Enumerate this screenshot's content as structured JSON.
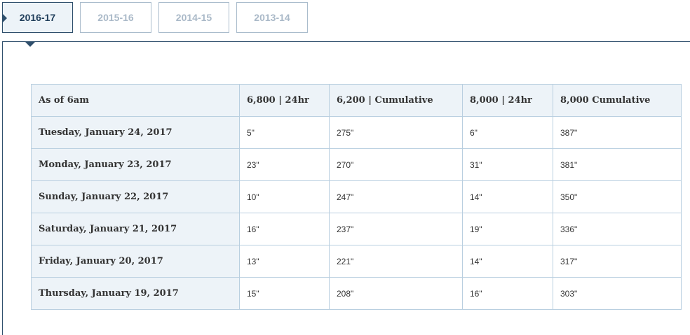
{
  "tabs": [
    {
      "label": "2016-17",
      "active": true
    },
    {
      "label": "2015-16",
      "active": false
    },
    {
      "label": "2014-15",
      "active": false
    },
    {
      "label": "2013-14",
      "active": false
    }
  ],
  "table": {
    "headers": [
      "As of 6am",
      "6,800 | 24hr",
      "6,200 | Cumulative",
      "8,000 | 24hr",
      "8,000 Cumulative"
    ],
    "rows": [
      {
        "date": "Tuesday, January 24, 2017",
        "c6800_24": "5\"",
        "c6200_cum": "275\"",
        "c8000_24": "6\"",
        "c8000_cum": "387\""
      },
      {
        "date": "Monday, January 23, 2017",
        "c6800_24": "23\"",
        "c6200_cum": "270\"",
        "c8000_24": "31\"",
        "c8000_cum": "381\""
      },
      {
        "date": "Sunday, January 22, 2017",
        "c6800_24": "10\"",
        "c6200_cum": "247\"",
        "c8000_24": "14\"",
        "c8000_cum": "350\""
      },
      {
        "date": "Saturday, January 21, 2017",
        "c6800_24": "16\"",
        "c6200_cum": "237\"",
        "c8000_24": "19\"",
        "c8000_cum": "336\""
      },
      {
        "date": "Friday, January 20, 2017",
        "c6800_24": "13\"",
        "c6200_cum": "221\"",
        "c8000_24": "14\"",
        "c8000_cum": "317\""
      },
      {
        "date": "Thursday, January 19, 2017",
        "c6800_24": "15\"",
        "c6200_cum": "208\"",
        "c8000_24": "16\"",
        "c8000_cum": "303\""
      }
    ]
  },
  "colors": {
    "accent": "#2f4f6c",
    "tab_inactive_text": "#aab9c8",
    "header_bg": "#edf3f8",
    "border": "#b9cfe0"
  }
}
